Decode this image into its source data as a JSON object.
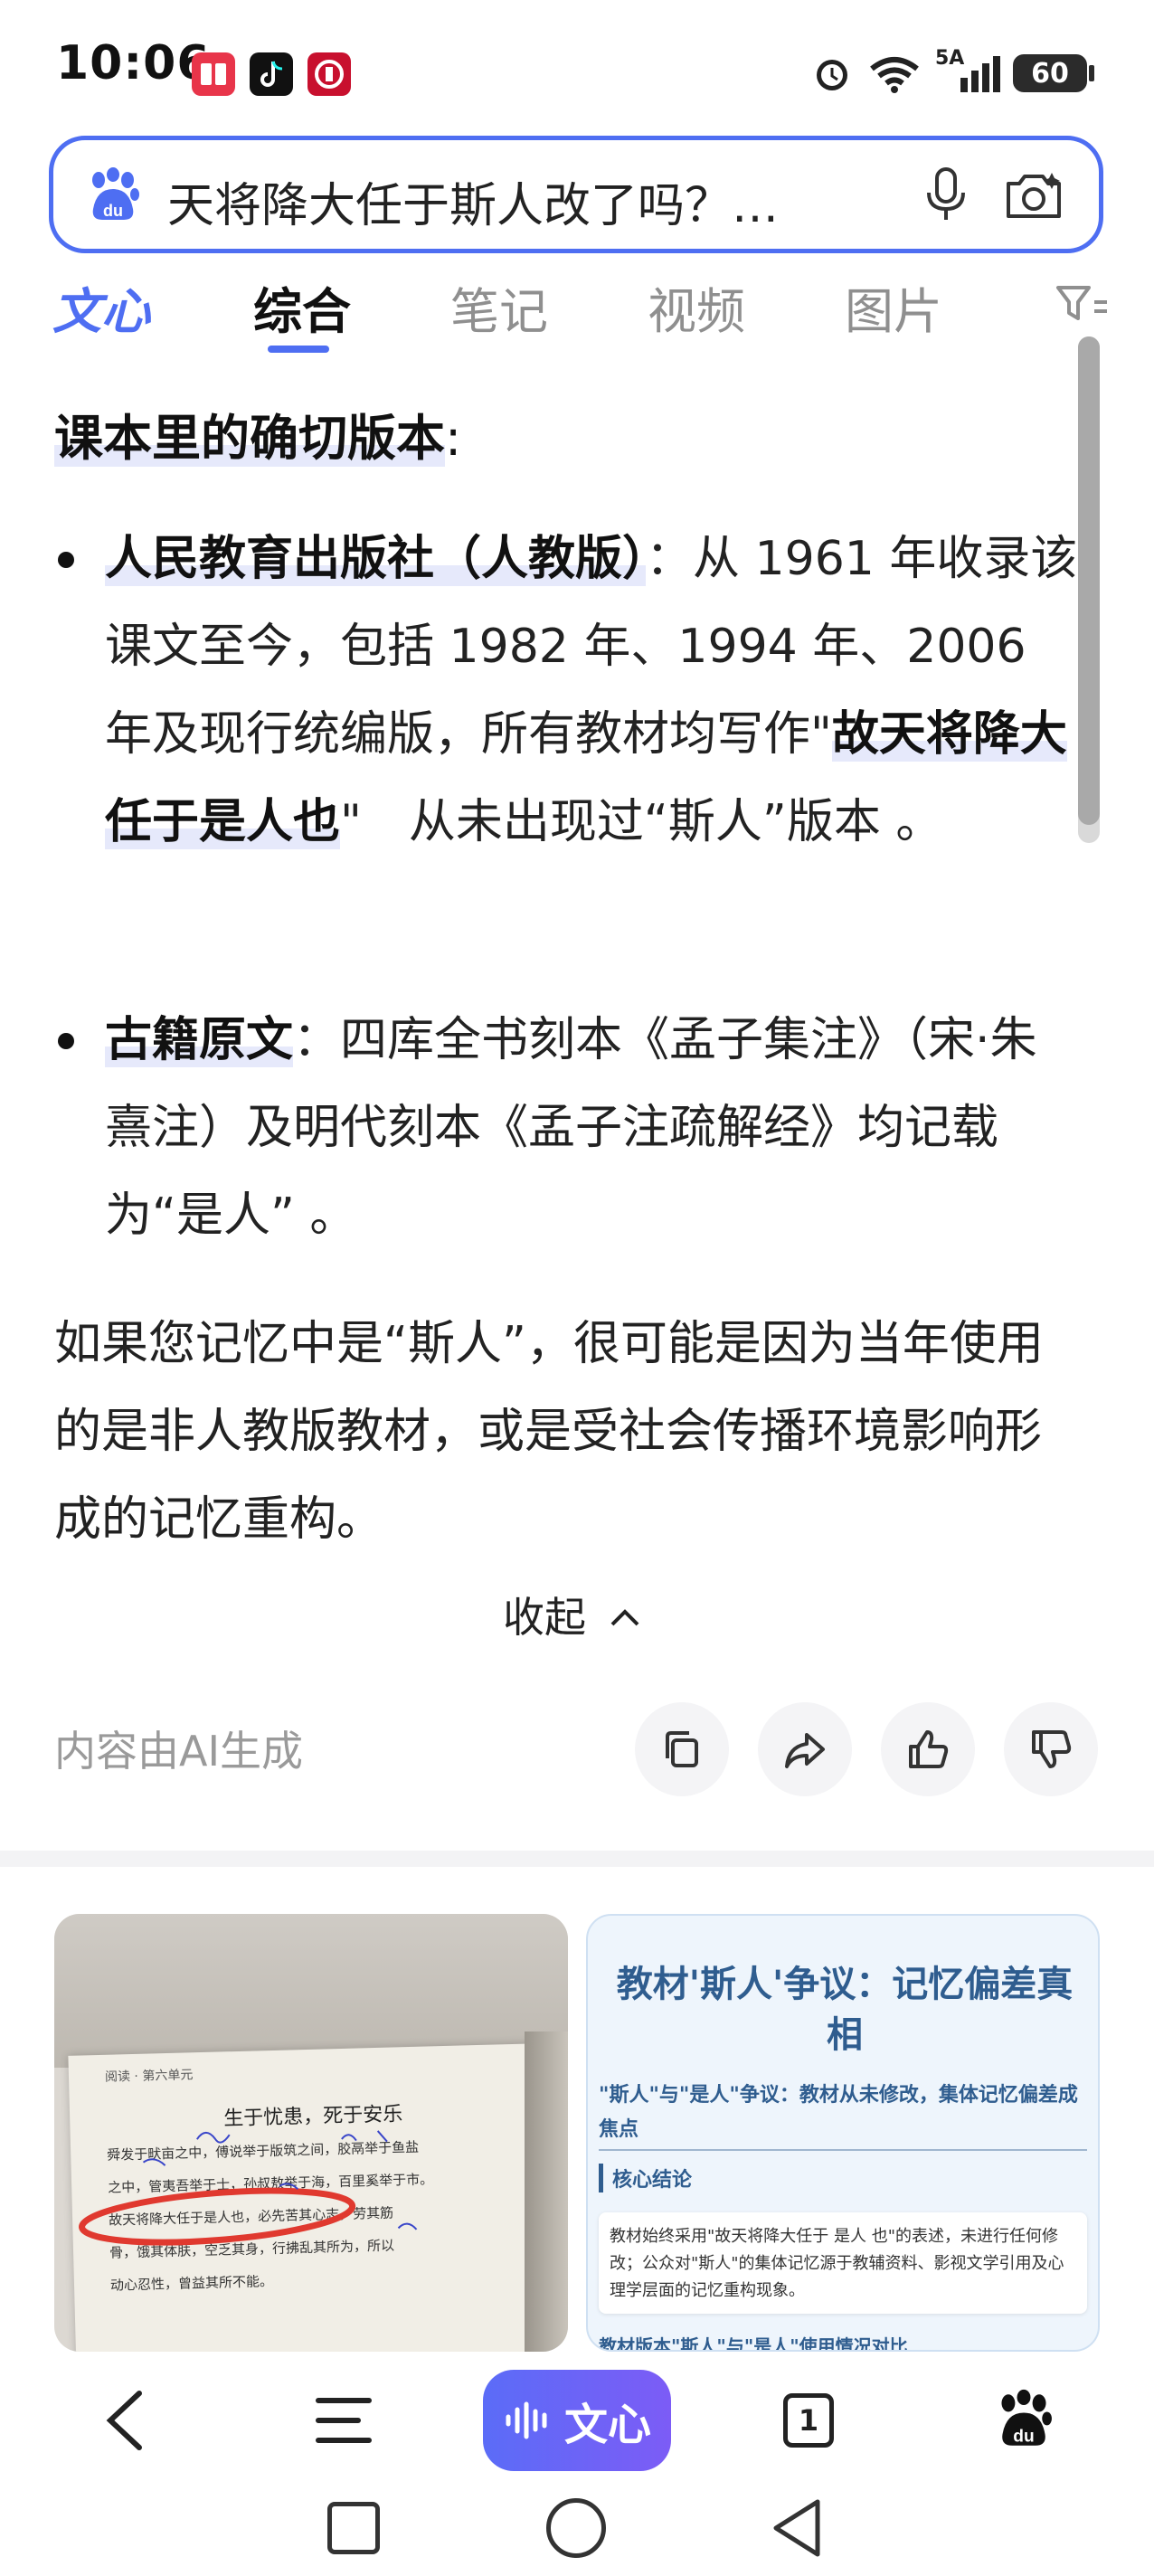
{
  "status_bar": {
    "time": "10:06",
    "network": "5A",
    "battery": "60"
  },
  "search": {
    "query": "天将降大任于斯人改了吗？…"
  },
  "tabs": [
    {
      "label": "文心"
    },
    {
      "label": "综合"
    },
    {
      "label": "笔记"
    },
    {
      "label": "视频"
    },
    {
      "label": "图片"
    }
  ],
  "content": {
    "heading": "课本里的确切版本",
    "heading_colon": ":",
    "bullet1": {
      "bold": "人民教育出版社（人教版）",
      "text_a": "：从 1961 年收录该课文至今，包括 1982 年、1994 年、2006 年及现行统编版，所有教材均写作\"",
      "bold2": "故天将降大任于是人也",
      "text_b": "\"　从未出现过“斯人”版本 。"
    },
    "bullet2": {
      "bold": "古籍原文",
      "text": "：四库全书刻本《孟子集注》（宋·朱熹注）及明代刻本《孟子注疏解经》均记载为“是人” 。"
    },
    "paragraph": "如果您记忆中是“斯人”，很可能是因为当年使用的是非人教版教材，或是受社会传播环境影响形成的记忆重构。",
    "collapse": "收起",
    "ai_note": "内容由AI生成"
  },
  "cards": {
    "photo": {
      "page_header": "阅读 · 第六单元",
      "title": "生于忧患，死于安乐",
      "lines": [
        "舜发于畎亩之中，傅说举于版筑之间，胶鬲举于鱼盐",
        "之中，管夷吾举于士，孙叔敖举于海，百里奚举于市。",
        "故天将降大任于是人也，必先苦其心志，劳其筋",
        "骨，饿其体肤，空乏其身，行拂乱其所为，所以",
        "动心忍性，曾益其所不能。"
      ]
    },
    "doc": {
      "title": "教材'斯人'争议：记忆偏差真相",
      "subtitle": "\"斯人\"与\"是人\"争议：教材从未修改，集体记忆偏差成焦点",
      "section": "核心结论",
      "box_text": "教材始终采用\"故天将降大任于 是人 也\"的表述，未进行任何修改；公众对\"斯人\"的集体记忆源于教辅资料、影视文学引用及心理学层面的记忆重构现象。",
      "cut_line": "教材版本\"斯人\"与\"是人\"使用情况对比"
    }
  },
  "bottom_nav": {
    "wenxin": "文心",
    "tab_count": "1"
  }
}
